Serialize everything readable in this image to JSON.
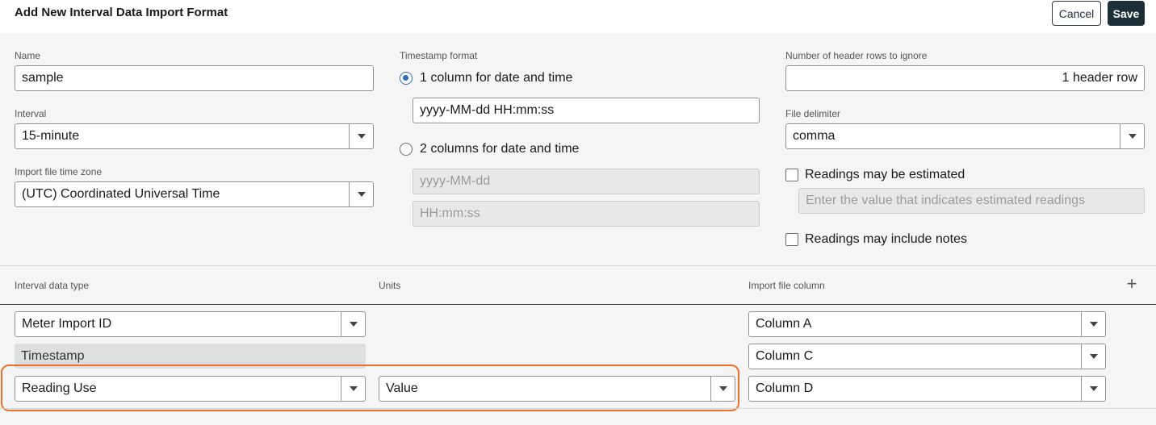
{
  "header": {
    "title": "Add New Interval Data Import Format",
    "cancel_label": "Cancel",
    "save_label": "Save"
  },
  "form": {
    "name": {
      "label": "Name",
      "value": "sample"
    },
    "interval": {
      "label": "Interval",
      "value": "15-minute"
    },
    "timezone": {
      "label": "Import file time zone",
      "value": "(UTC) Coordinated Universal Time"
    },
    "timestamp": {
      "label": "Timestamp format",
      "option1_label": "1 column for date and time",
      "option1_value": "yyyy-MM-dd HH:mm:ss",
      "option2_label": "2 columns for date and time",
      "option2_date_placeholder": "yyyy-MM-dd",
      "option2_time_placeholder": "HH:mm:ss",
      "selected": "option1"
    },
    "header_rows": {
      "label": "Number of header rows to ignore",
      "value": "1 header row"
    },
    "delimiter": {
      "label": "File delimiter",
      "value": "comma"
    },
    "estimated": {
      "label": "Readings may be estimated",
      "placeholder": "Enter the value that indicates estimated readings",
      "checked": false
    },
    "notes": {
      "label": "Readings may include notes",
      "checked": false
    }
  },
  "mapping": {
    "headers": {
      "data_type": "Interval data type",
      "units": "Units",
      "column": "Import file column"
    },
    "rows": [
      {
        "data_type": "Meter Import ID",
        "units": "",
        "column": "Column A"
      },
      {
        "data_type": "Timestamp",
        "units": "",
        "column": "Column C"
      },
      {
        "data_type": "Reading Use",
        "units": "Value",
        "column": "Column D"
      }
    ]
  },
  "colors": {
    "accent": "#2f6fba",
    "save_bg": "#1c2e38",
    "highlight": "#ee7127"
  }
}
